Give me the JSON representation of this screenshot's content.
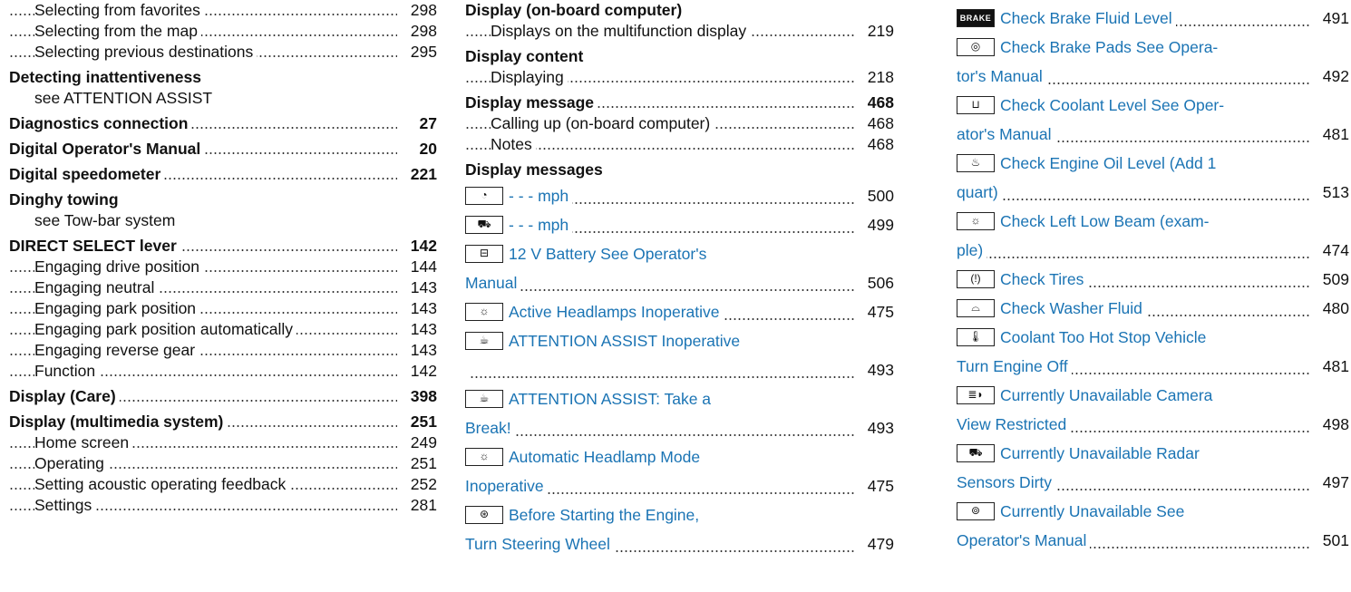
{
  "col1": [
    {
      "text": "Selecting from favorites",
      "page": "298",
      "style": "sub"
    },
    {
      "text": "Selecting from the map",
      "page": "298",
      "style": "sub"
    },
    {
      "text": "Selecting previous destinations",
      "page": "295",
      "style": "sub"
    },
    {
      "text": "Detecting inattentiveness",
      "page": "",
      "style": "head"
    },
    {
      "text": "see ATTENTION ASSIST",
      "page": "",
      "style": "sub"
    },
    {
      "text": "Diagnostics connection",
      "page": "27",
      "style": "head"
    },
    {
      "text": "Digital Operator's Manual",
      "page": "20",
      "style": "head"
    },
    {
      "text": "Digital speedometer",
      "page": "221",
      "style": "head"
    },
    {
      "text": "Dinghy towing",
      "page": "",
      "style": "head"
    },
    {
      "text": "see Tow-bar system",
      "page": "",
      "style": "sub"
    },
    {
      "text": "DIRECT SELECT lever",
      "page": "142",
      "style": "head"
    },
    {
      "text": "Engaging drive position",
      "page": "144",
      "style": "sub"
    },
    {
      "text": "Engaging neutral",
      "page": "143",
      "style": "sub"
    },
    {
      "text": "Engaging park position",
      "page": "143",
      "style": "sub"
    },
    {
      "text": "Engaging park position automatically",
      "page": "143",
      "style": "sub"
    },
    {
      "text": "Engaging reverse gear",
      "page": "143",
      "style": "sub"
    },
    {
      "text": "Function",
      "page": "142",
      "style": "sub"
    },
    {
      "text": "Display (Care)",
      "page": "398",
      "style": "head"
    },
    {
      "text": "Display (multimedia system)",
      "page": "251",
      "style": "head"
    },
    {
      "text": "Home screen",
      "page": "249",
      "style": "sub"
    },
    {
      "text": "Operating",
      "page": "251",
      "style": "sub"
    },
    {
      "text": "Setting acoustic operating feedback",
      "page": "252",
      "style": "sub"
    },
    {
      "text": "Settings",
      "page": "281",
      "style": "sub"
    }
  ],
  "col2": [
    {
      "text": "Display (on-board computer)",
      "page": "",
      "style": "head"
    },
    {
      "text": "Displays on the multifunction display",
      "page": "219",
      "style": "sub"
    },
    {
      "text": "Display content",
      "page": "",
      "style": "head"
    },
    {
      "text": "Displaying",
      "page": "218",
      "style": "sub"
    },
    {
      "text": "Display message",
      "page": "468",
      "style": "head"
    },
    {
      "text": "Calling up (on-board computer)",
      "page": "468",
      "style": "sub"
    },
    {
      "text": "Notes",
      "page": "468",
      "style": "sub"
    },
    {
      "text": "Display messages",
      "page": "",
      "style": "head"
    },
    {
      "text": "- - - mph",
      "page": "500",
      "style": "tall",
      "icon": "speedometer-icon",
      "glyph": "◔",
      "link": true
    },
    {
      "text": "- - - mph",
      "page": "499",
      "style": "tall",
      "icon": "radar-car-icon",
      "glyph": "⛟",
      "link": true
    },
    {
      "text": "12 V Battery See Operator's",
      "page": "",
      "style": "tall",
      "icon": "battery-icon",
      "glyph": "⊟",
      "link": true
    },
    {
      "text": "Manual",
      "page": "506",
      "style": "tall",
      "link": true
    },
    {
      "text": "Active Headlamps Inoperative",
      "page": "475",
      "style": "tall",
      "icon": "headlamp-icon",
      "glyph": "☼",
      "link": true
    },
    {
      "text": "ATTENTION ASSIST Inoperative",
      "page": "",
      "style": "tall",
      "icon": "coffee-cup-icon",
      "glyph": "☕",
      "link": true
    },
    {
      "text": "",
      "page": "493",
      "style": "tall"
    },
    {
      "text": "ATTENTION ASSIST: Take a",
      "page": "",
      "style": "tall",
      "icon": "coffee-cup-icon",
      "glyph": "☕",
      "link": true
    },
    {
      "text": "Break!",
      "page": "493",
      "style": "tall",
      "link": true
    },
    {
      "text": "Automatic Headlamp Mode",
      "page": "",
      "style": "tall",
      "icon": "headlamp-icon",
      "glyph": "☼",
      "link": true
    },
    {
      "text": "Inoperative",
      "page": "475",
      "style": "tall",
      "link": true
    },
    {
      "text": "Before Starting the Engine,",
      "page": "",
      "style": "tall",
      "icon": "steering-wheel-icon",
      "glyph": "⊛",
      "link": true
    },
    {
      "text": "Turn Steering Wheel",
      "page": "479",
      "style": "tall",
      "link": true
    }
  ],
  "col3": [
    {
      "text": "Check Brake Fluid Level",
      "page": "491",
      "style": "tall",
      "icon": "brake-icon",
      "glyph": "BRAKE",
      "link": true
    },
    {
      "text": "Check Brake Pads See Opera-",
      "page": "",
      "style": "tall",
      "icon": "brake-pads-icon",
      "glyph": "◎",
      "link": true
    },
    {
      "text": "tor's Manual",
      "page": "492",
      "style": "tall",
      "link": true
    },
    {
      "text": "Check Coolant Level See Oper-",
      "page": "",
      "style": "tall",
      "icon": "coolant-reservoir-icon",
      "glyph": "⊔",
      "link": true
    },
    {
      "text": "ator's Manual",
      "page": "481",
      "style": "tall",
      "link": true
    },
    {
      "text": "Check Engine Oil Level (Add 1",
      "page": "",
      "style": "tall",
      "icon": "oil-can-icon",
      "glyph": "♨",
      "link": true
    },
    {
      "text": "quart)",
      "page": "513",
      "style": "tall",
      "link": true
    },
    {
      "text": "Check Left Low Beam (exam-",
      "page": "",
      "style": "tall",
      "icon": "lamp-icon",
      "glyph": "☼",
      "link": true
    },
    {
      "text": "ple)",
      "page": "474",
      "style": "tall",
      "link": true
    },
    {
      "text": "Check Tires",
      "page": "509",
      "style": "tall",
      "icon": "tire-pressure-icon",
      "glyph": "(!)",
      "link": true
    },
    {
      "text": "Check Washer Fluid",
      "page": "480",
      "style": "tall",
      "icon": "washer-fluid-icon",
      "glyph": "⌓",
      "link": true
    },
    {
      "text": "Coolant Too Hot Stop Vehicle",
      "page": "",
      "style": "tall",
      "icon": "coolant-temperature-icon",
      "glyph": "🌡",
      "link": true
    },
    {
      "text": "Turn Engine Off",
      "page": "481",
      "style": "tall",
      "link": true
    },
    {
      "text": "Currently Unavailable Camera",
      "page": "",
      "style": "tall",
      "icon": "camera-light-icon",
      "glyph": "≣◗",
      "link": true
    },
    {
      "text": "View Restricted",
      "page": "498",
      "style": "tall",
      "link": true
    },
    {
      "text": "Currently Unavailable Radar",
      "page": "",
      "style": "tall",
      "icon": "radar-car-icon",
      "glyph": "⛟",
      "link": true
    },
    {
      "text": "Sensors Dirty",
      "page": "497",
      "style": "tall",
      "link": true
    },
    {
      "text": "Currently Unavailable See",
      "page": "",
      "style": "tall",
      "icon": "warning-circle-icon",
      "glyph": "⊚",
      "link": true
    },
    {
      "text": "Operator's Manual",
      "page": "501",
      "style": "tall",
      "link": true
    }
  ]
}
